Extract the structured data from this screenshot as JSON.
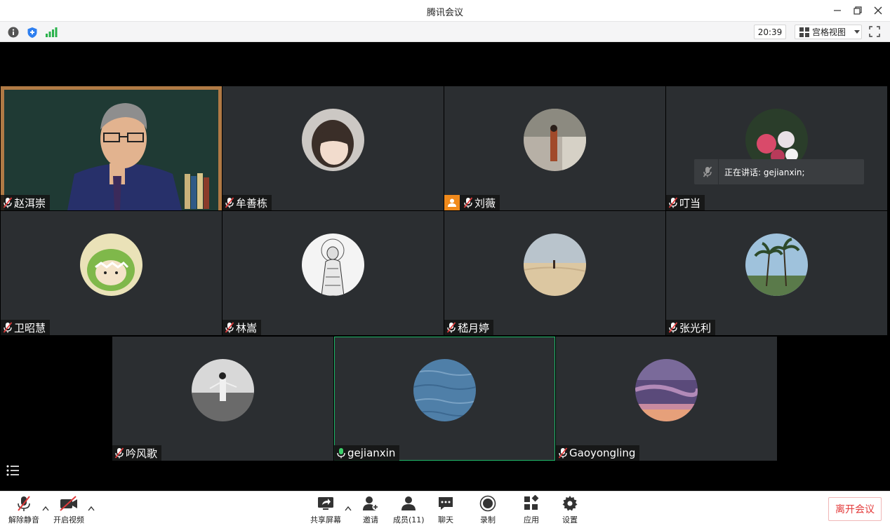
{
  "window": {
    "title": "腾讯会议"
  },
  "infobar": {
    "time": "20:39",
    "view_mode": "宫格视图"
  },
  "speaking": {
    "label": "正在讲话: gejianxin;"
  },
  "participants": [
    {
      "name": "赵洱崇",
      "avatar": "video-feed"
    },
    {
      "name": "牟善栋",
      "avatar": "child-photo"
    },
    {
      "name": "刘薇",
      "avatar": "woman-photo",
      "host": true
    },
    {
      "name": "叮当",
      "avatar": "flowers-photo"
    },
    {
      "name": "卫昭慧",
      "avatar": "cartoon-dino"
    },
    {
      "name": "林嵩",
      "avatar": "sketch-figure"
    },
    {
      "name": "嵇月婷",
      "avatar": "desert-photo"
    },
    {
      "name": "张光利",
      "avatar": "palm-trees-photo"
    },
    {
      "name": "吟风歌",
      "avatar": "beach-bw-photo"
    },
    {
      "name": "gejianxin",
      "avatar": "water-photo",
      "speaking": true
    },
    {
      "name": "Gaoyongling",
      "avatar": "sunset-photo"
    }
  ],
  "toolbar": {
    "unmute": "解除静音",
    "start_video": "开启视频",
    "share_screen": "共享屏幕",
    "invite": "邀请",
    "members": "成员(11)",
    "chat": "聊天",
    "record": "录制",
    "apps": "应用",
    "settings": "设置",
    "leave": "离开会议"
  },
  "colors": {
    "tile_bg": "#2b2e31",
    "accent_green": "#1fb86a",
    "leave_red": "#e33a3a",
    "host_orange": "#f08a1c"
  }
}
